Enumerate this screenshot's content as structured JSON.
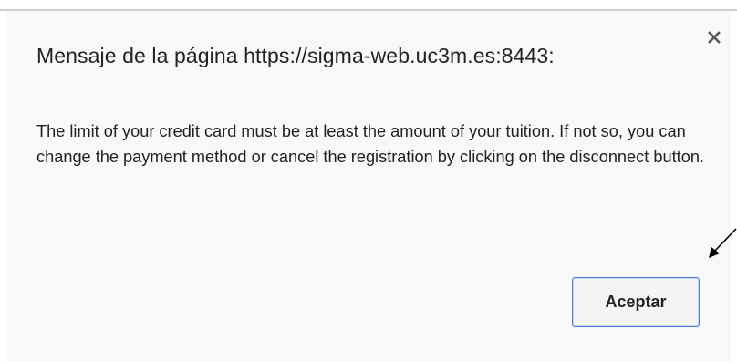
{
  "dialog": {
    "title": "Mensaje de la página https://sigma-web.uc3m.es:8443:",
    "close_glyph": "×",
    "message": "The limit of your credit card must be at least the amount of your tuition. If not so, you can change the payment method or cancel the registration by clicking on the disconnect button.",
    "accept_label": "Aceptar"
  },
  "colors": {
    "dialog_background": "#f8f8f8",
    "button_border": "#4a7bd8",
    "text": "#222222"
  },
  "icons": {
    "close": "close-icon",
    "annotation": "annotation-arrow-icon"
  }
}
